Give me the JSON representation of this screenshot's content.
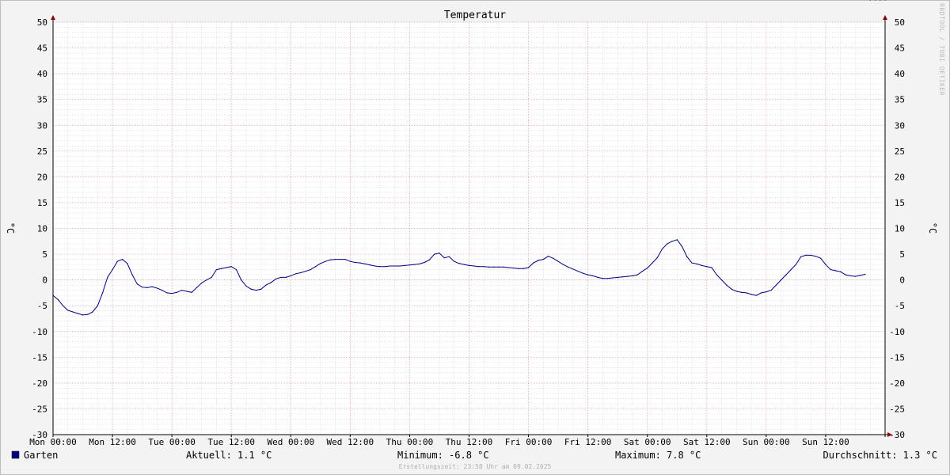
{
  "chart_data": {
    "type": "line",
    "title": "Temperatur",
    "ylabel": "°C",
    "ylim": [
      -30,
      50
    ],
    "y_ticks": [
      "50",
      "45",
      "40",
      "35",
      "30",
      "25",
      "20",
      "15",
      "10",
      "5",
      "0",
      "-5",
      "-10",
      "-15",
      "-20",
      "-25",
      "-30"
    ],
    "x_ticks": [
      "Mon 00:00",
      "Mon 12:00",
      "Tue 00:00",
      "Tue 12:00",
      "Wed 00:00",
      "Wed 12:00",
      "Thu 00:00",
      "Thu 12:00",
      "Fri 00:00",
      "Fri 12:00",
      "Sat 00:00",
      "Sat 12:00",
      "Sun 00:00",
      "Sun 12:00"
    ],
    "x_range_hours": [
      0,
      168
    ],
    "grid": true,
    "legend_position": "bottom-left",
    "series": [
      {
        "name": "Garten",
        "color": "#000080",
        "x_hours": [
          0,
          1,
          2,
          3,
          4,
          5,
          6,
          7,
          8,
          9,
          10,
          11,
          12,
          13,
          14,
          15,
          16,
          17,
          18,
          19,
          20,
          21,
          22,
          23,
          24,
          25,
          26,
          27,
          28,
          29,
          30,
          31,
          32,
          33,
          34,
          35,
          36,
          37,
          38,
          39,
          40,
          41,
          42,
          43,
          44,
          45,
          46,
          47,
          48,
          49,
          50,
          51,
          52,
          53,
          54,
          55,
          56,
          57,
          58,
          59,
          60,
          61,
          62,
          63,
          64,
          65,
          66,
          67,
          68,
          69,
          70,
          71,
          72,
          73,
          74,
          75,
          76,
          77,
          78,
          79,
          80,
          81,
          82,
          83,
          84,
          85,
          86,
          87,
          88,
          89,
          90,
          91,
          92,
          93,
          94,
          95,
          96,
          97,
          98,
          99,
          100,
          101,
          102,
          103,
          104,
          105,
          106,
          107,
          108,
          109,
          110,
          111,
          112,
          113,
          114,
          115,
          116,
          117,
          118,
          119,
          120,
          121,
          122,
          123,
          124,
          125,
          126,
          127,
          128,
          129,
          130,
          131,
          132,
          133,
          134,
          135,
          136,
          137,
          138,
          139,
          140,
          141,
          142,
          143,
          144,
          145,
          146,
          147,
          148,
          149,
          150,
          151,
          152,
          153,
          154,
          155,
          156,
          157,
          158,
          159,
          160,
          161,
          162,
          163,
          164,
          165,
          166,
          167,
          168
        ],
        "values": [
          -3.0,
          -3.8,
          -5.0,
          -5.9,
          -6.2,
          -6.5,
          -6.8,
          -6.7,
          -6.2,
          -5.0,
          -2.5,
          0.5,
          2.0,
          3.6,
          4.0,
          3.2,
          1.0,
          -0.8,
          -1.4,
          -1.5,
          -1.3,
          -1.6,
          -2.0,
          -2.5,
          -2.6,
          -2.4,
          -2.0,
          -2.2,
          -2.4,
          -1.5,
          -0.6,
          0.0,
          0.5,
          2.0,
          2.2,
          2.4,
          2.6,
          2.0,
          0.0,
          -1.2,
          -1.8,
          -2.0,
          -1.8,
          -1.0,
          -0.5,
          0.2,
          0.5,
          0.5,
          0.8,
          1.2,
          1.4,
          1.7,
          2.0,
          2.6,
          3.2,
          3.6,
          3.9,
          4.0,
          4.0,
          4.0,
          3.6,
          3.4,
          3.3,
          3.1,
          2.9,
          2.7,
          2.6,
          2.6,
          2.7,
          2.7,
          2.7,
          2.8,
          2.9,
          3.0,
          3.1,
          3.4,
          3.9,
          5.0,
          5.2,
          4.3,
          4.5,
          3.6,
          3.2,
          3.0,
          2.8,
          2.7,
          2.6,
          2.6,
          2.5,
          2.5,
          2.5,
          2.5,
          2.4,
          2.3,
          2.2,
          2.2,
          2.4,
          3.3,
          3.8,
          4.0,
          4.6,
          4.2,
          3.6,
          3.0,
          2.5,
          2.1,
          1.7,
          1.3,
          1.0,
          0.8,
          0.5,
          0.3,
          0.3,
          0.4,
          0.5,
          0.6,
          0.7,
          0.8,
          1.0,
          1.7,
          2.3,
          3.3,
          4.3,
          6.0,
          7.0,
          7.5,
          7.8,
          6.5,
          4.5,
          3.3,
          3.1,
          2.8,
          2.6,
          2.4,
          1.0,
          0.0,
          -1.0,
          -1.8,
          -2.2,
          -2.4,
          -2.5,
          -2.8,
          -3.0,
          -2.5,
          -2.3,
          -2.0,
          -1.0,
          0.0,
          1.0,
          2.0,
          3.0,
          4.5,
          4.8,
          4.8,
          4.6,
          4.2,
          3.0,
          2.0,
          1.8,
          1.6,
          1.0,
          0.8,
          0.7,
          0.9,
          1.1
        ]
      }
    ]
  },
  "watermark": "RRDTOOL / TOBI OETIKER",
  "legend": {
    "series_name": "Garten",
    "series_color": "#000080"
  },
  "stats": {
    "current": "Aktuell: 1.1 °C",
    "minimum": "Minimum: -6.8 °C",
    "maximum": "Maximum: 7.8 °C",
    "average": "Durchschnitt: 1.3 °C"
  },
  "created": "Erstellungszeit: 23:58 Uhr am 09.02.2025"
}
